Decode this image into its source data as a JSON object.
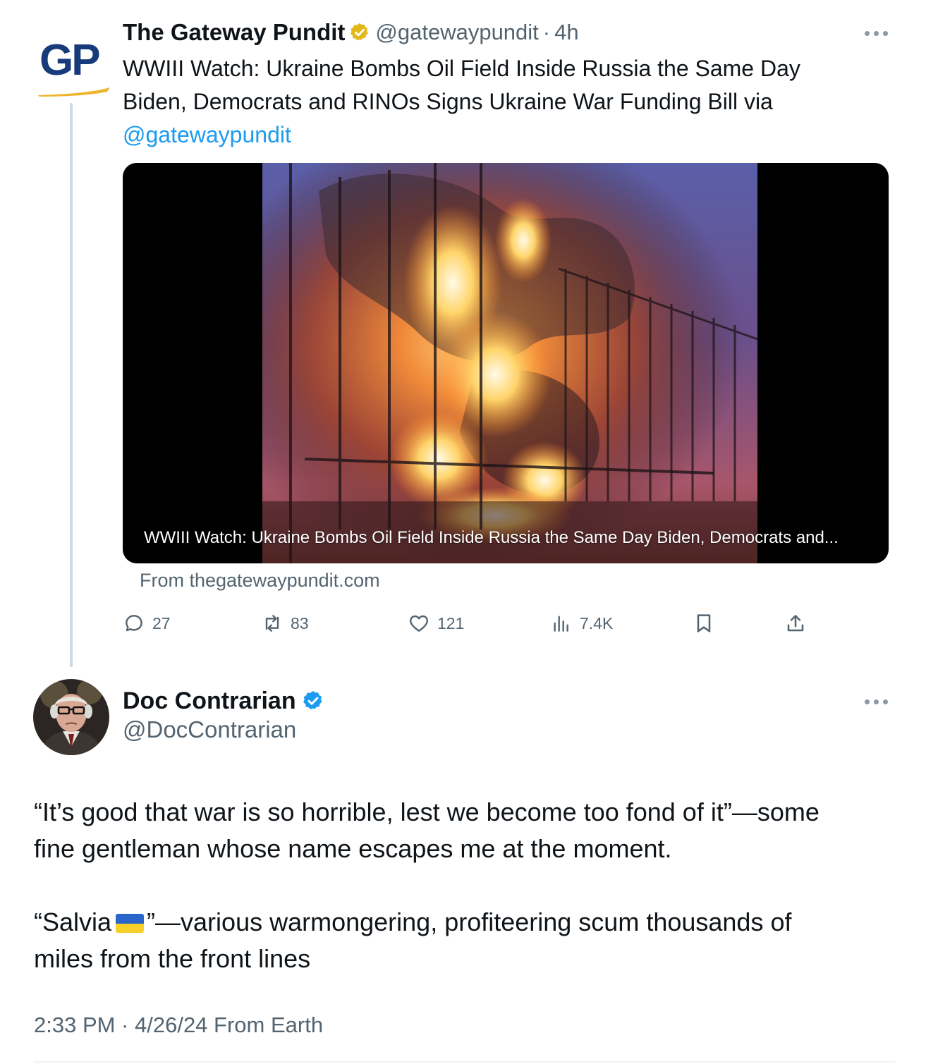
{
  "parent_tweet": {
    "avatar_logo_text": "GP",
    "display_name": "The Gateway Pundit",
    "verified_badge": "gold-check",
    "handle": "@gatewaypundit",
    "separator": "·",
    "time_ago": "4h",
    "text_lines": [
      "WWIII Watch: Ukraine Bombs Oil Field Inside Russia the Same Day",
      "Biden, Democrats and RINOs Signs Ukraine War Funding Bill via"
    ],
    "mention": "@gatewaypundit",
    "card": {
      "caption": "WWIII Watch: Ukraine Bombs Oil Field Inside Russia the Same Day Biden, Democrats and...",
      "source": "From thegatewaypundit.com"
    },
    "actions": {
      "replies": "27",
      "reposts": "83",
      "likes": "121",
      "views": "7.4K"
    }
  },
  "reply_tweet": {
    "display_name": "Doc Contrarian",
    "verified_badge": "blue-check",
    "handle": "@DocContrarian",
    "paragraph1_lines": [
      "“It’s good that war is so horrible, lest we become too fond of it”—some",
      "fine gentleman whose name escapes me at the moment."
    ],
    "paragraph2_prefix": "“Salvia",
    "paragraph2_flag": "ukraine-flag",
    "paragraph2_rest": "”—various warmongering, profiteering scum thousands of",
    "paragraph2_line2": "miles from the front lines",
    "timestamp": "2:33 PM · 4/26/24 From Earth"
  },
  "colors": {
    "text": "#0f1419",
    "secondary": "#536471",
    "link": "#1d9bf0",
    "thread_line": "#cfd9de",
    "gp_blue": "#173a7a",
    "gp_gold": "#f0b429"
  }
}
